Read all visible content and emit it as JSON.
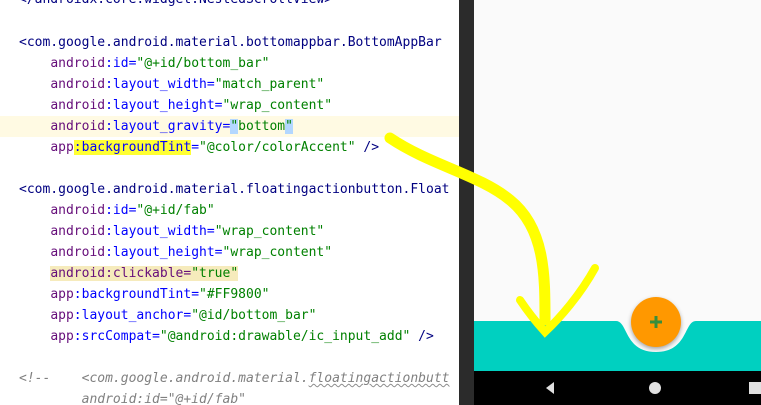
{
  "editor": {
    "lines": [
      {
        "segments": [
          {
            "t": "</androidx.core.widget.NestedScrollView>",
            "c": "tok-tag"
          }
        ]
      },
      {
        "segments": []
      },
      {
        "segments": [
          {
            "t": "<com.google.android.material.bottomappbar.BottomAppBar",
            "c": "tok-tag"
          }
        ]
      },
      {
        "segments": [
          {
            "t": "    "
          },
          {
            "t": "android",
            "c": "tok-ns"
          },
          {
            "t": ":id=",
            "c": "tok-attr"
          },
          {
            "t": "\"@+id/bottom_bar\"",
            "c": "tok-val"
          }
        ]
      },
      {
        "segments": [
          {
            "t": "    "
          },
          {
            "t": "android",
            "c": "tok-ns"
          },
          {
            "t": ":layout_width=",
            "c": "tok-attr"
          },
          {
            "t": "\"match_parent\"",
            "c": "tok-val"
          }
        ]
      },
      {
        "segments": [
          {
            "t": "    "
          },
          {
            "t": "android",
            "c": "tok-ns"
          },
          {
            "t": ":layout_height=",
            "c": "tok-attr"
          },
          {
            "t": "\"wrap_content\"",
            "c": "tok-val"
          }
        ]
      },
      {
        "caret": true,
        "segments": [
          {
            "t": "    "
          },
          {
            "t": "android",
            "c": "tok-ns"
          },
          {
            "t": ":layout_gravity=",
            "c": "tok-attr"
          },
          {
            "t": "\"",
            "c": "tok-val hl-sel"
          },
          {
            "t": "bottom",
            "c": "tok-val"
          },
          {
            "t": "\"",
            "c": "tok-val hl-sel"
          }
        ]
      },
      {
        "segments": [
          {
            "t": "    "
          },
          {
            "t": "app",
            "c": "tok-ns"
          },
          {
            "t": ":backgroundTint",
            "c": "tok-attr hl-yellow"
          },
          {
            "t": "=",
            "c": "tok-attr"
          },
          {
            "t": "\"@color/colorAccent\"",
            "c": "tok-val"
          },
          {
            "t": " />",
            "c": "tok-tag"
          }
        ]
      },
      {
        "segments": []
      },
      {
        "segments": [
          {
            "t": "<com.google.android.material.floatingactionbutton.Float",
            "c": "tok-tag"
          }
        ]
      },
      {
        "segments": [
          {
            "t": "    "
          },
          {
            "t": "android",
            "c": "tok-ns"
          },
          {
            "t": ":id=",
            "c": "tok-attr"
          },
          {
            "t": "\"@+id/fab\"",
            "c": "tok-val"
          }
        ]
      },
      {
        "segments": [
          {
            "t": "    "
          },
          {
            "t": "android",
            "c": "tok-ns"
          },
          {
            "t": ":layout_width=",
            "c": "tok-attr"
          },
          {
            "t": "\"wrap_content\"",
            "c": "tok-val"
          }
        ]
      },
      {
        "segments": [
          {
            "t": "    "
          },
          {
            "t": "android",
            "c": "tok-ns"
          },
          {
            "t": ":layout_height=",
            "c": "tok-attr"
          },
          {
            "t": "\"wrap_content\"",
            "c": "tok-val"
          }
        ]
      },
      {
        "segments": [
          {
            "t": "    "
          },
          {
            "t": "android:clickable=",
            "c": "tok-ns hl-warn"
          },
          {
            "t": "\"true\"",
            "c": "tok-val hl-warn"
          }
        ]
      },
      {
        "segments": [
          {
            "t": "    "
          },
          {
            "t": "app",
            "c": "tok-ns"
          },
          {
            "t": ":backgroundTint=",
            "c": "tok-attr"
          },
          {
            "t": "\"#FF9800\"",
            "c": "tok-val"
          }
        ]
      },
      {
        "segments": [
          {
            "t": "    "
          },
          {
            "t": "app",
            "c": "tok-ns"
          },
          {
            "t": ":layout_anchor=",
            "c": "tok-attr"
          },
          {
            "t": "\"@id/bottom_bar\"",
            "c": "tok-val"
          }
        ]
      },
      {
        "segments": [
          {
            "t": "    "
          },
          {
            "t": "app",
            "c": "tok-ns"
          },
          {
            "t": ":srcCompat=",
            "c": "tok-attr"
          },
          {
            "t": "\"@android:drawable/ic_input_add\"",
            "c": "tok-val"
          },
          {
            "t": " />",
            "c": "tok-tag"
          }
        ]
      },
      {
        "segments": []
      },
      {
        "segments": [
          {
            "t": "<!--    <com.google.android.material.",
            "c": "tok-comment"
          },
          {
            "t": "floatingactionbutt",
            "c": "tok-comment squiggle"
          }
        ]
      },
      {
        "segments": [
          {
            "t": "        android:id=\"@+id/fab\"",
            "c": "tok-comment"
          }
        ]
      }
    ]
  },
  "preview": {
    "bottom_bar_color": "#00d0c0",
    "fab_color": "#ff9800",
    "fab_icon": "plus-icon",
    "nav_buttons": [
      {
        "name": "back",
        "icon": "back-triangle-icon"
      },
      {
        "name": "home",
        "icon": "home-circle-icon"
      },
      {
        "name": "recents",
        "icon": "recents-square-icon"
      }
    ]
  },
  "annotation": {
    "color": "#ffff00",
    "shape": "curved-arrow"
  }
}
